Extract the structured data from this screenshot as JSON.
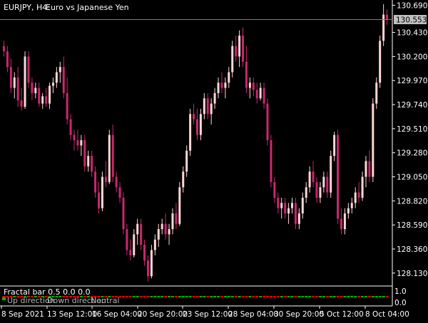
{
  "header": {
    "symbol": "EURJPY, H4:",
    "description": "Euro vs Japanese Yen"
  },
  "price_axis": {
    "ticks": [
      "130.690",
      "130.430",
      "130.200",
      "129.970",
      "129.740",
      "129.510",
      "129.280",
      "129.050",
      "128.820",
      "128.590",
      "128.360",
      "128.130"
    ],
    "current_price": "130.553"
  },
  "time_axis": {
    "ticks": [
      "8 Sep 2021",
      "13 Sep 12:00",
      "16 Sep 04:00",
      "20 Sep 20:00",
      "23 Sep 12:00",
      "28 Sep 04:00",
      "30 Sep 20:00",
      "5 Oct 12:00",
      "8 Oct 04:00"
    ]
  },
  "indicator": {
    "title": "Fractal bar 0.5 0.0 0.0",
    "legend": [
      "Up direction",
      "Down direction",
      "Neutral"
    ],
    "axis_ticks": [
      "1.0",
      "0.0"
    ],
    "colors": {
      "up": "#00b400",
      "down": "#e60000",
      "neutral": "#b4b4b4"
    }
  },
  "colors": {
    "bull": "#ffd6d6",
    "bear": "#c8286e",
    "background": "#000000",
    "text": "#ffffff",
    "price_tag_bg": "#c0c0c0",
    "price_line": "#808080"
  },
  "chart_data": {
    "type": "candlestick",
    "title": "EURJPY, H4: Euro vs Japanese Yen",
    "ylim": [
      128.02,
      130.74
    ],
    "candles": [
      {
        "o": 130.3,
        "h": 130.35,
        "l": 130.2,
        "c": 130.25
      },
      {
        "o": 130.25,
        "h": 130.3,
        "l": 130.05,
        "c": 130.1
      },
      {
        "o": 130.1,
        "h": 130.18,
        "l": 129.85,
        "c": 129.9
      },
      {
        "o": 129.9,
        "h": 130.05,
        "l": 129.8,
        "c": 130.0
      },
      {
        "o": 130.0,
        "h": 130.1,
        "l": 129.72,
        "c": 129.78
      },
      {
        "o": 129.78,
        "h": 129.9,
        "l": 129.68,
        "c": 129.72
      },
      {
        "o": 129.72,
        "h": 130.25,
        "l": 129.7,
        "c": 130.2
      },
      {
        "o": 130.2,
        "h": 130.25,
        "l": 129.9,
        "c": 129.95
      },
      {
        "o": 129.95,
        "h": 130.0,
        "l": 129.78,
        "c": 129.85
      },
      {
        "o": 129.85,
        "h": 129.95,
        "l": 129.8,
        "c": 129.9
      },
      {
        "o": 129.9,
        "h": 129.95,
        "l": 129.72,
        "c": 129.75
      },
      {
        "o": 129.75,
        "h": 129.85,
        "l": 129.7,
        "c": 129.82
      },
      {
        "o": 129.82,
        "h": 129.9,
        "l": 129.72,
        "c": 129.75
      },
      {
        "o": 129.75,
        "h": 129.95,
        "l": 129.7,
        "c": 129.92
      },
      {
        "o": 129.92,
        "h": 130.0,
        "l": 129.85,
        "c": 129.95
      },
      {
        "o": 129.95,
        "h": 130.1,
        "l": 129.9,
        "c": 130.05
      },
      {
        "o": 130.05,
        "h": 130.15,
        "l": 129.95,
        "c": 130.1
      },
      {
        "o": 130.1,
        "h": 130.2,
        "l": 129.8,
        "c": 129.85
      },
      {
        "o": 129.85,
        "h": 130.0,
        "l": 129.55,
        "c": 129.6
      },
      {
        "o": 129.6,
        "h": 129.65,
        "l": 129.4,
        "c": 129.45
      },
      {
        "o": 129.45,
        "h": 129.5,
        "l": 129.3,
        "c": 129.4
      },
      {
        "o": 129.4,
        "h": 129.5,
        "l": 129.3,
        "c": 129.35
      },
      {
        "o": 129.35,
        "h": 129.45,
        "l": 129.25,
        "c": 129.4
      },
      {
        "o": 129.4,
        "h": 129.45,
        "l": 129.1,
        "c": 129.15
      },
      {
        "o": 129.15,
        "h": 129.3,
        "l": 129.1,
        "c": 129.25
      },
      {
        "o": 129.25,
        "h": 129.3,
        "l": 129.05,
        "c": 129.1
      },
      {
        "o": 129.1,
        "h": 129.15,
        "l": 128.85,
        "c": 128.9
      },
      {
        "o": 128.9,
        "h": 129.0,
        "l": 128.7,
        "c": 128.75
      },
      {
        "o": 128.75,
        "h": 129.1,
        "l": 128.72,
        "c": 129.05
      },
      {
        "o": 129.05,
        "h": 129.2,
        "l": 128.95,
        "c": 129.0
      },
      {
        "o": 129.0,
        "h": 129.5,
        "l": 128.98,
        "c": 129.45
      },
      {
        "o": 129.45,
        "h": 129.55,
        "l": 129.0,
        "c": 129.05
      },
      {
        "o": 129.05,
        "h": 129.1,
        "l": 128.9,
        "c": 128.95
      },
      {
        "o": 128.95,
        "h": 129.0,
        "l": 128.8,
        "c": 128.85
      },
      {
        "o": 128.85,
        "h": 128.9,
        "l": 128.5,
        "c": 128.55
      },
      {
        "o": 128.55,
        "h": 128.6,
        "l": 128.3,
        "c": 128.35
      },
      {
        "o": 128.35,
        "h": 128.45,
        "l": 128.25,
        "c": 128.3
      },
      {
        "o": 128.3,
        "h": 128.55,
        "l": 128.28,
        "c": 128.5
      },
      {
        "o": 128.5,
        "h": 128.65,
        "l": 128.4,
        "c": 128.6
      },
      {
        "o": 128.6,
        "h": 128.65,
        "l": 128.35,
        "c": 128.4
      },
      {
        "o": 128.4,
        "h": 128.45,
        "l": 128.2,
        "c": 128.25
      },
      {
        "o": 128.25,
        "h": 128.3,
        "l": 128.05,
        "c": 128.1
      },
      {
        "o": 128.1,
        "h": 128.4,
        "l": 128.08,
        "c": 128.35
      },
      {
        "o": 128.35,
        "h": 128.5,
        "l": 128.3,
        "c": 128.45
      },
      {
        "o": 128.45,
        "h": 128.6,
        "l": 128.38,
        "c": 128.55
      },
      {
        "o": 128.55,
        "h": 128.65,
        "l": 128.5,
        "c": 128.6
      },
      {
        "o": 128.6,
        "h": 128.7,
        "l": 128.45,
        "c": 128.5
      },
      {
        "o": 128.5,
        "h": 128.6,
        "l": 128.4,
        "c": 128.55
      },
      {
        "o": 128.55,
        "h": 128.75,
        "l": 128.5,
        "c": 128.7
      },
      {
        "o": 128.7,
        "h": 128.8,
        "l": 128.55,
        "c": 128.6
      },
      {
        "o": 128.6,
        "h": 129.0,
        "l": 128.58,
        "c": 128.95
      },
      {
        "o": 128.95,
        "h": 129.15,
        "l": 128.9,
        "c": 129.1
      },
      {
        "o": 129.1,
        "h": 129.35,
        "l": 129.05,
        "c": 129.3
      },
      {
        "o": 129.3,
        "h": 129.7,
        "l": 129.25,
        "c": 129.65
      },
      {
        "o": 129.65,
        "h": 129.75,
        "l": 129.55,
        "c": 129.6
      },
      {
        "o": 129.6,
        "h": 129.7,
        "l": 129.4,
        "c": 129.45
      },
      {
        "o": 129.45,
        "h": 129.7,
        "l": 129.4,
        "c": 129.65
      },
      {
        "o": 129.65,
        "h": 129.85,
        "l": 129.6,
        "c": 129.8
      },
      {
        "o": 129.8,
        "h": 129.85,
        "l": 129.6,
        "c": 129.65
      },
      {
        "o": 129.65,
        "h": 129.8,
        "l": 129.55,
        "c": 129.75
      },
      {
        "o": 129.75,
        "h": 129.9,
        "l": 129.7,
        "c": 129.85
      },
      {
        "o": 129.85,
        "h": 130.0,
        "l": 129.8,
        "c": 129.95
      },
      {
        "o": 129.95,
        "h": 130.05,
        "l": 129.85,
        "c": 129.9
      },
      {
        "o": 129.9,
        "h": 130.0,
        "l": 129.8,
        "c": 129.95
      },
      {
        "o": 129.95,
        "h": 130.1,
        "l": 129.9,
        "c": 130.05
      },
      {
        "o": 130.05,
        "h": 130.35,
        "l": 130.0,
        "c": 130.3
      },
      {
        "o": 130.3,
        "h": 130.4,
        "l": 130.15,
        "c": 130.2
      },
      {
        "o": 130.2,
        "h": 130.45,
        "l": 130.1,
        "c": 130.4
      },
      {
        "o": 130.4,
        "h": 130.48,
        "l": 130.1,
        "c": 130.15
      },
      {
        "o": 130.15,
        "h": 130.3,
        "l": 129.85,
        "c": 129.9
      },
      {
        "o": 129.9,
        "h": 130.0,
        "l": 129.8,
        "c": 129.95
      },
      {
        "o": 129.95,
        "h": 130.0,
        "l": 129.82,
        "c": 129.88
      },
      {
        "o": 129.88,
        "h": 129.95,
        "l": 129.75,
        "c": 129.8
      },
      {
        "o": 129.8,
        "h": 129.95,
        "l": 129.78,
        "c": 129.9
      },
      {
        "o": 129.9,
        "h": 129.95,
        "l": 129.7,
        "c": 129.75
      },
      {
        "o": 129.75,
        "h": 129.8,
        "l": 129.35,
        "c": 129.4
      },
      {
        "o": 129.4,
        "h": 129.45,
        "l": 128.95,
        "c": 129.0
      },
      {
        "o": 129.0,
        "h": 129.05,
        "l": 128.8,
        "c": 128.85
      },
      {
        "o": 128.85,
        "h": 128.9,
        "l": 128.7,
        "c": 128.75
      },
      {
        "o": 128.75,
        "h": 128.85,
        "l": 128.65,
        "c": 128.8
      },
      {
        "o": 128.8,
        "h": 128.85,
        "l": 128.65,
        "c": 128.7
      },
      {
        "o": 128.7,
        "h": 128.8,
        "l": 128.6,
        "c": 128.75
      },
      {
        "o": 128.75,
        "h": 128.85,
        "l": 128.7,
        "c": 128.8
      },
      {
        "o": 128.8,
        "h": 128.85,
        "l": 128.55,
        "c": 128.6
      },
      {
        "o": 128.6,
        "h": 128.75,
        "l": 128.55,
        "c": 128.7
      },
      {
        "o": 128.7,
        "h": 128.9,
        "l": 128.65,
        "c": 128.85
      },
      {
        "o": 128.85,
        "h": 129.0,
        "l": 128.8,
        "c": 128.95
      },
      {
        "o": 128.95,
        "h": 129.15,
        "l": 128.9,
        "c": 129.1
      },
      {
        "o": 129.1,
        "h": 129.2,
        "l": 128.95,
        "c": 129.0
      },
      {
        "o": 129.0,
        "h": 129.05,
        "l": 128.8,
        "c": 128.85
      },
      {
        "o": 128.85,
        "h": 129.0,
        "l": 128.8,
        "c": 128.95
      },
      {
        "o": 128.95,
        "h": 129.1,
        "l": 128.9,
        "c": 129.05
      },
      {
        "o": 129.05,
        "h": 129.1,
        "l": 128.85,
        "c": 128.9
      },
      {
        "o": 128.9,
        "h": 129.3,
        "l": 128.85,
        "c": 129.25
      },
      {
        "o": 129.25,
        "h": 129.48,
        "l": 129.2,
        "c": 129.45
      },
      {
        "o": 129.45,
        "h": 129.5,
        "l": 128.6,
        "c": 128.65
      },
      {
        "o": 128.65,
        "h": 128.75,
        "l": 128.5,
        "c": 128.55
      },
      {
        "o": 128.55,
        "h": 128.75,
        "l": 128.5,
        "c": 128.7
      },
      {
        "o": 128.7,
        "h": 128.8,
        "l": 128.65,
        "c": 128.75
      },
      {
        "o": 128.75,
        "h": 128.85,
        "l": 128.7,
        "c": 128.8
      },
      {
        "o": 128.8,
        "h": 128.95,
        "l": 128.75,
        "c": 128.9
      },
      {
        "o": 128.9,
        "h": 129.0,
        "l": 128.8,
        "c": 128.85
      },
      {
        "o": 128.85,
        "h": 129.1,
        "l": 128.82,
        "c": 129.05
      },
      {
        "o": 129.05,
        "h": 129.25,
        "l": 128.95,
        "c": 129.2
      },
      {
        "o": 129.2,
        "h": 129.3,
        "l": 129.0,
        "c": 129.05
      },
      {
        "o": 129.05,
        "h": 129.8,
        "l": 129.0,
        "c": 129.75
      },
      {
        "o": 129.75,
        "h": 130.0,
        "l": 129.7,
        "c": 129.95
      },
      {
        "o": 129.95,
        "h": 130.4,
        "l": 129.9,
        "c": 130.35
      },
      {
        "o": 130.35,
        "h": 130.7,
        "l": 130.3,
        "c": 130.6
      },
      {
        "o": 130.6,
        "h": 130.65,
        "l": 130.5,
        "c": 130.553
      }
    ]
  }
}
